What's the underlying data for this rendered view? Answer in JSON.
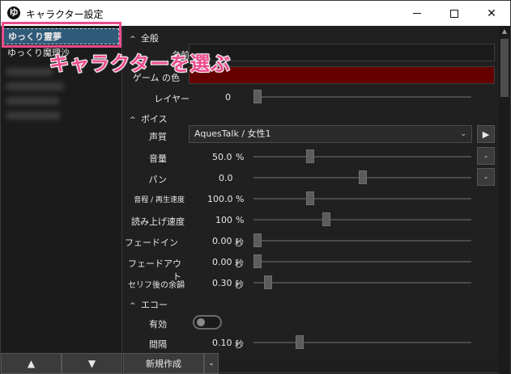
{
  "window": {
    "title": "キャラクター設定",
    "app_icon": "ゆ",
    "minimize_icon": "minimize-icon",
    "maximize_icon": "maximize-icon",
    "close_icon": "close-icon",
    "close_glyph": "✕"
  },
  "character_list": {
    "items": [
      {
        "label": "ゆっくり霊夢",
        "selected": true
      },
      {
        "label": "ゆっくり魔理沙",
        "selected": false
      }
    ],
    "up_label": "▲",
    "down_label": "▼"
  },
  "callout": {
    "text": "キャラクターを選ぶ",
    "color": "#ea4c8c"
  },
  "sections": {
    "general": "全般",
    "voice": "ボイス",
    "echo": "エコー",
    "chevron": "^"
  },
  "general": {
    "name_label": "名前",
    "color_label": "ゲーム の色",
    "color_value": "#650000",
    "layer_label": "レイヤー",
    "layer_value": "0",
    "layer_fraction": 0.0
  },
  "voice": {
    "quality_label": "声質",
    "quality_value": "AquesTalk / 女性1",
    "play_label": "▶",
    "minus_label": "-",
    "volume_label": "音量",
    "volume_value": "50.0",
    "volume_unit": "%",
    "volume_fraction": 0.25,
    "pan_label": "パン",
    "pan_value": "0.0",
    "pan_fraction": 0.5,
    "pitch_label": "音程 / 再生速度",
    "pitch_value": "100.0",
    "pitch_unit": "%",
    "pitch_fraction": 0.25,
    "read_speed_label": "読み上げ速度",
    "read_speed_value": "100",
    "read_speed_unit": "%",
    "read_speed_fraction": 0.33,
    "fadein_label": "フェードイン",
    "fadein_value": "0.00",
    "fadein_unit": "秒",
    "fadein_fraction": 0.0,
    "fadeout_label": "フェードアウト",
    "fadeout_value": "0.00",
    "fadeout_unit": "秒",
    "fadeout_fraction": 0.0,
    "margin_label": "セリフ後の余韻",
    "margin_value": "0.30",
    "margin_unit": "秒",
    "margin_fraction": 0.05
  },
  "echo": {
    "enabled_label": "有効",
    "enabled": false,
    "interval_label": "間隔",
    "interval_value": "0.10",
    "interval_unit": "秒",
    "interval_fraction": 0.2
  },
  "footer": {
    "new_label": "新規作成",
    "dropdown_label": "⌄"
  }
}
